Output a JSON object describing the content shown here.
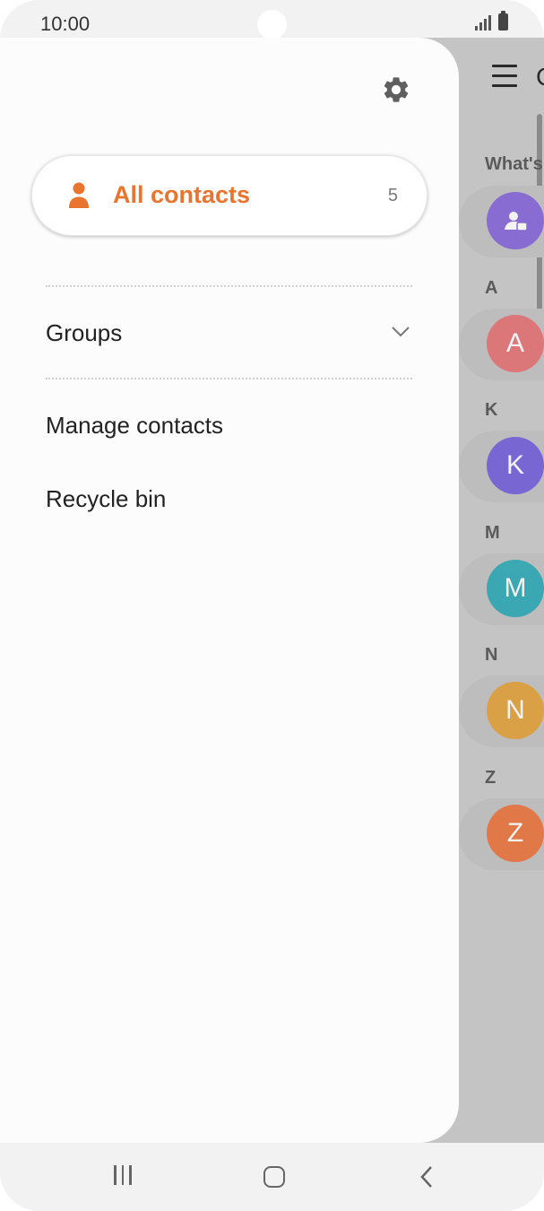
{
  "status_bar": {
    "time": "10:00",
    "icons": [
      "signal-icon",
      "battery-icon"
    ]
  },
  "background_screen": {
    "title_initial": "C",
    "sections": [
      {
        "header": "What's",
        "avatar_letter": "",
        "avatar_icon": "profile-card-icon",
        "color": "#7d5bd6"
      },
      {
        "header": "A",
        "avatar_letter": "A",
        "color": "#e2676b"
      },
      {
        "header": "K",
        "avatar_letter": "K",
        "color": "#6a55d8"
      },
      {
        "header": "M",
        "avatar_letter": "M",
        "color": "#1fa3b0"
      },
      {
        "header": "N",
        "avatar_letter": "N",
        "color": "#e09a2c"
      },
      {
        "header": "Z",
        "avatar_letter": "Z",
        "color": "#e8692f"
      }
    ]
  },
  "drawer": {
    "settings_icon": "gear-icon",
    "all_contacts": {
      "label": "All contacts",
      "count": "5",
      "icon": "person-icon"
    },
    "groups": {
      "label": "Groups",
      "icon": "chevron-down-icon"
    },
    "items": [
      {
        "label": "Manage contacts"
      },
      {
        "label": "Recycle bin"
      }
    ]
  },
  "nav_bar": {
    "buttons": [
      "recent-apps-icon",
      "home-icon",
      "back-icon"
    ]
  },
  "colors": {
    "accent": "#e8742f",
    "drawer_bg": "#fcfcfc",
    "scrim": "#c4c4c4"
  }
}
